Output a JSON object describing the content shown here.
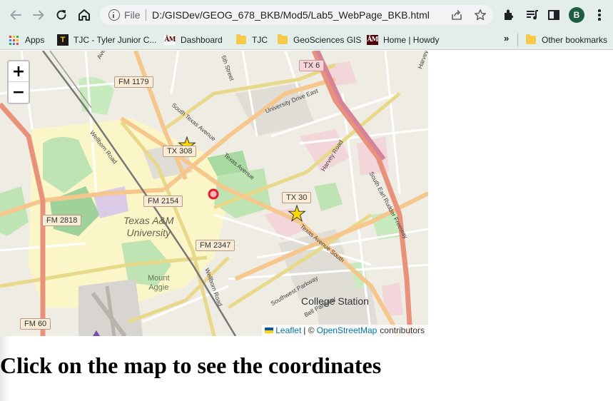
{
  "browser": {
    "scheme": "File",
    "url": "D:/GISDev/GEOG_678_BKB/Mod5/Lab5_WebPage_BKB.html",
    "profile_initial": "B",
    "bookmarks": [
      {
        "label": "Apps",
        "icon": "apps-grid-icon"
      },
      {
        "label": "TJC - Tyler Junior C...",
        "icon": "tjc-logo-icon"
      },
      {
        "label": "Dashboard",
        "icon": "atm-logo-icon"
      },
      {
        "label": "TJC",
        "icon": "folder-icon"
      },
      {
        "label": "GeoSciences GIS",
        "icon": "folder-icon"
      },
      {
        "label": "Home | Howdy",
        "icon": "atm-logo-icon"
      }
    ],
    "overflow_label": "»",
    "other_bookmarks": "Other bookmarks"
  },
  "map": {
    "zoom_in": "+",
    "zoom_out": "−",
    "attribution": {
      "leaflet": "Leaflet",
      "sep": "| ©",
      "osm": "OpenStreetMap",
      "suffix": "contributors"
    },
    "shields": [
      {
        "label": "FM 1179",
        "kind": "farm"
      },
      {
        "label": "TX 6",
        "kind": "state"
      },
      {
        "label": "TX 308",
        "kind": "farm"
      },
      {
        "label": "TX 30",
        "kind": "farm"
      },
      {
        "label": "FM 2154",
        "kind": "farm"
      },
      {
        "label": "FM 2818",
        "kind": "farm"
      },
      {
        "label": "FM 2347",
        "kind": "farm"
      },
      {
        "label": "FM 60",
        "kind": "farm"
      }
    ],
    "places": {
      "university": [
        "Texas A&M",
        "University"
      ],
      "mount": [
        "Mount",
        "Aggie"
      ],
      "city": "College Station"
    },
    "streets": {
      "wellborn_upper": "Wellborn Road",
      "wellborn_lower": "Wellborn Road",
      "south_texas": "South Texas Avenue",
      "texas_ave": "Texas Avenue",
      "texas_south": "Texas Avenue South",
      "university_dr": "University Drive East",
      "harvey": "Harvey Road",
      "earl_rudder": "South Earl Rudder Freeway",
      "southwest_pkwy": "Southwest Parkway",
      "bell_pkwy": "Bell Parkway",
      "fifth_st": "5th Street",
      "avenue": "Avenue",
      "harvey_east": "Harvey"
    },
    "markers": [
      {
        "type": "star",
        "color": "#ffd700"
      },
      {
        "type": "star",
        "color": "#ffd700"
      },
      {
        "type": "circle",
        "color": "#e8192c"
      }
    ]
  },
  "page": {
    "heading": "Click on the map to see the coordinates"
  }
}
